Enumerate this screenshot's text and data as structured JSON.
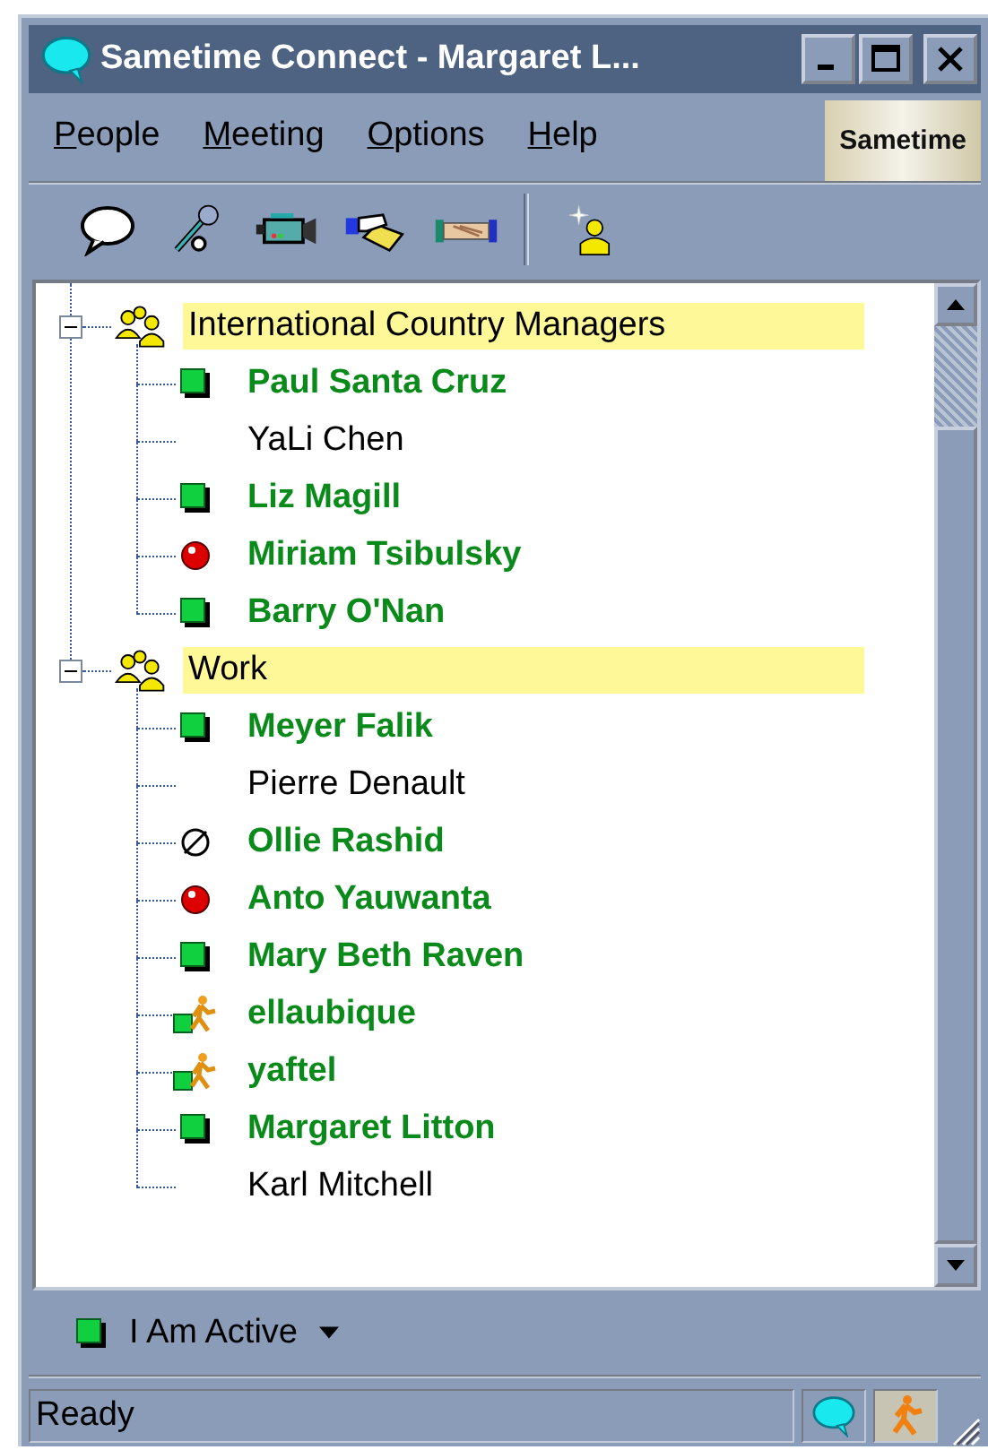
{
  "window": {
    "title": "Sametime Connect - Margaret L..."
  },
  "menu": [
    "People",
    "Meeting",
    "Options",
    "Help"
  ],
  "brand_logo": "Sametime",
  "groups": [
    {
      "name": "International Country Managers",
      "expanded": true,
      "members": [
        {
          "name": "Paul Santa Cruz",
          "kind": "active"
        },
        {
          "name": "YaLi Chen",
          "kind": "offline"
        },
        {
          "name": "Liz Magill",
          "kind": "active"
        },
        {
          "name": "Miriam Tsibulsky",
          "kind": "away"
        },
        {
          "name": "Barry O'Nan",
          "kind": "active"
        }
      ]
    },
    {
      "name": "Work",
      "expanded": true,
      "members": [
        {
          "name": "Meyer Falik",
          "kind": "active"
        },
        {
          "name": "Pierre Denault",
          "kind": "offline"
        },
        {
          "name": "Ollie Rashid",
          "kind": "dnd"
        },
        {
          "name": "Anto Yauwanta",
          "kind": "away"
        },
        {
          "name": "Mary Beth Raven",
          "kind": "active"
        },
        {
          "name": "ellaubique",
          "kind": "mobile"
        },
        {
          "name": "yaftel",
          "kind": "mobile"
        },
        {
          "name": "Margaret Litton",
          "kind": "active"
        },
        {
          "name": "Karl Mitchell",
          "kind": "offline"
        }
      ]
    }
  ],
  "my_status": {
    "label": "I Am Active",
    "kind": "active"
  },
  "status_bar": {
    "text": "Ready"
  }
}
